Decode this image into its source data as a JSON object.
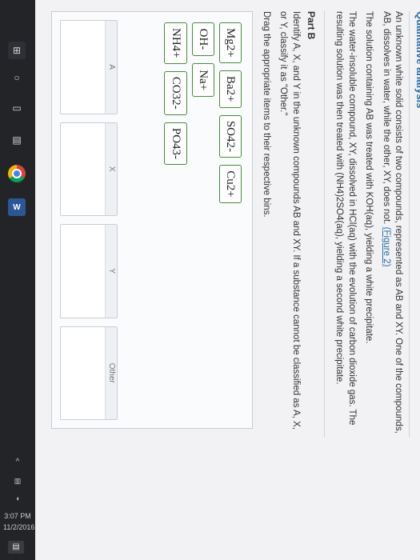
{
  "taskbar": {
    "word_label": "W",
    "tray": {
      "up_arrow": "^",
      "time": "3:07 PM",
      "date": "11/2/2016",
      "notif": "▤"
    }
  },
  "page": {
    "section_title": "Qualitative analysis",
    "intro": "An unknown white solid consists of two compounds, represented as AB and XY. One of the compounds, AB, dissolves in water, while the other, XY, does not.",
    "figure_link": "(Figure 2)",
    "p2": "The solution containing AB was treated with KOH(aq), yielding a white precipitate.",
    "p3": "The water-insoluble compound, XY, dissolved in HCl(aq) with the evolution of carbon dioxide gas. The resulting solution was then treated with (NH4)2SO4(aq), yielding a second white precipitate.",
    "part_b_title": "Part B",
    "part_b_instr": "Identify A, X, and Y in the unknown compounds AB and XY. If a substance cannot be classified as A, X, or Y, classify it as \"Other.\"",
    "drag_instr": "Drag the appropriate items to their respective bins.",
    "chips": [
      "Mg2+",
      "Ba2+",
      "SO42-",
      "Cu2+",
      "OH-",
      "Na+",
      "NH4+",
      "CO32-",
      "PO43-"
    ],
    "bins": [
      "A",
      "X",
      "Y",
      "Other"
    ]
  }
}
